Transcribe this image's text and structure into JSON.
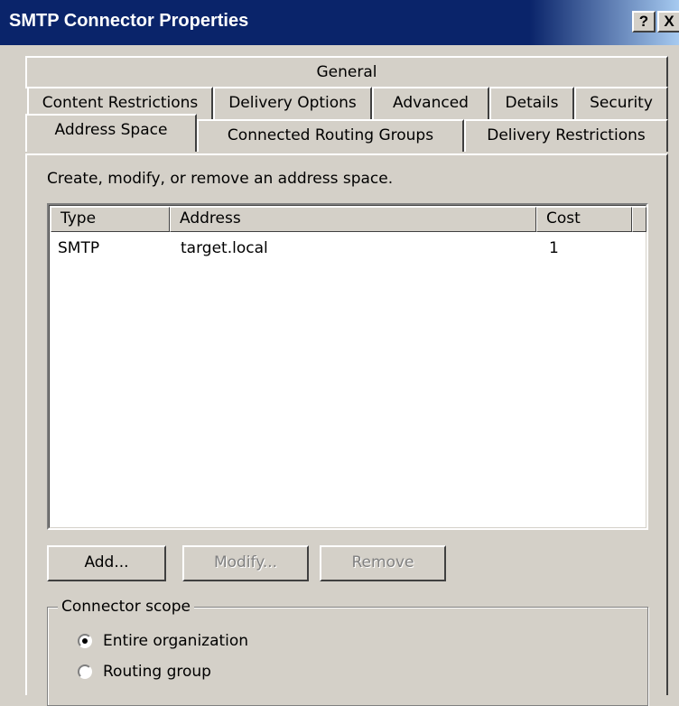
{
  "window": {
    "title": "SMTP Connector Properties",
    "help_button": "?",
    "close_button": "X"
  },
  "tabs": {
    "row1": [
      "General"
    ],
    "row2": [
      "Content Restrictions",
      "Delivery Options",
      "Advanced",
      "Details",
      "Security"
    ],
    "row3": [
      "Address Space",
      "Connected Routing Groups",
      "Delivery Restrictions"
    ],
    "active": "Address Space"
  },
  "address_space": {
    "description": "Create, modify, or remove an address space.",
    "columns": [
      "Type",
      "Address",
      "Cost"
    ],
    "rows": [
      {
        "type": "SMTP",
        "address": "target.local",
        "cost": "1"
      }
    ]
  },
  "buttons": {
    "add": "Add...",
    "modify": "Modify...",
    "remove": "Remove"
  },
  "connector_scope": {
    "legend": "Connector scope",
    "options": [
      {
        "label": "Entire organization",
        "selected": true
      },
      {
        "label": "Routing group",
        "selected": false
      }
    ]
  }
}
